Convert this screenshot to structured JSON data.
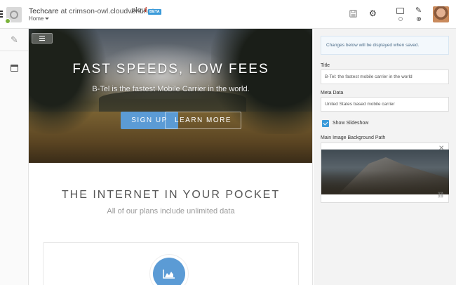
{
  "header": {
    "site_title": "Techcare",
    "at_text": "at",
    "domain": "crimson-owl.cloudvent.net",
    "page_selector": "Home",
    "logo_text": "ploy",
    "beta_label": "BETA"
  },
  "icons": {
    "hamburger": "hamburger-icon",
    "save": "save-icon",
    "settings": "gear-icon",
    "desktop": "desktop-icon",
    "edit": "pencil-icon"
  },
  "sidebar": {
    "items": [
      {
        "name": "edit",
        "icon": "pencil-icon"
      },
      {
        "name": "calendar",
        "icon": "calendar-icon"
      }
    ]
  },
  "preview": {
    "hero": {
      "title": "FAST SPEEDS, LOW FEES",
      "subtitle": "B-Tel is the fastest Mobile Carrier in the world.",
      "signup_label": "SIGN UP",
      "learn_more_label": "LEARN MORE"
    },
    "section": {
      "title": "THE INTERNET IN YOUR POCKET",
      "subtitle": "All of our plans include unlimited data"
    }
  },
  "panel": {
    "notice": "Changes below will be displayed when saved.",
    "title_label": "Title",
    "title_value": "B-Tel: the fastest mobile carrier in the world",
    "meta_label": "Meta Data",
    "meta_value": "United States based mobile carrier",
    "slideshow_label": "Show Slideshow",
    "slideshow_checked": true,
    "image_label": "Main Image Background Path"
  },
  "colors": {
    "accent": "#5b9bd5",
    "beta": "#3a9ad9",
    "status_ok": "#7ab23a"
  }
}
